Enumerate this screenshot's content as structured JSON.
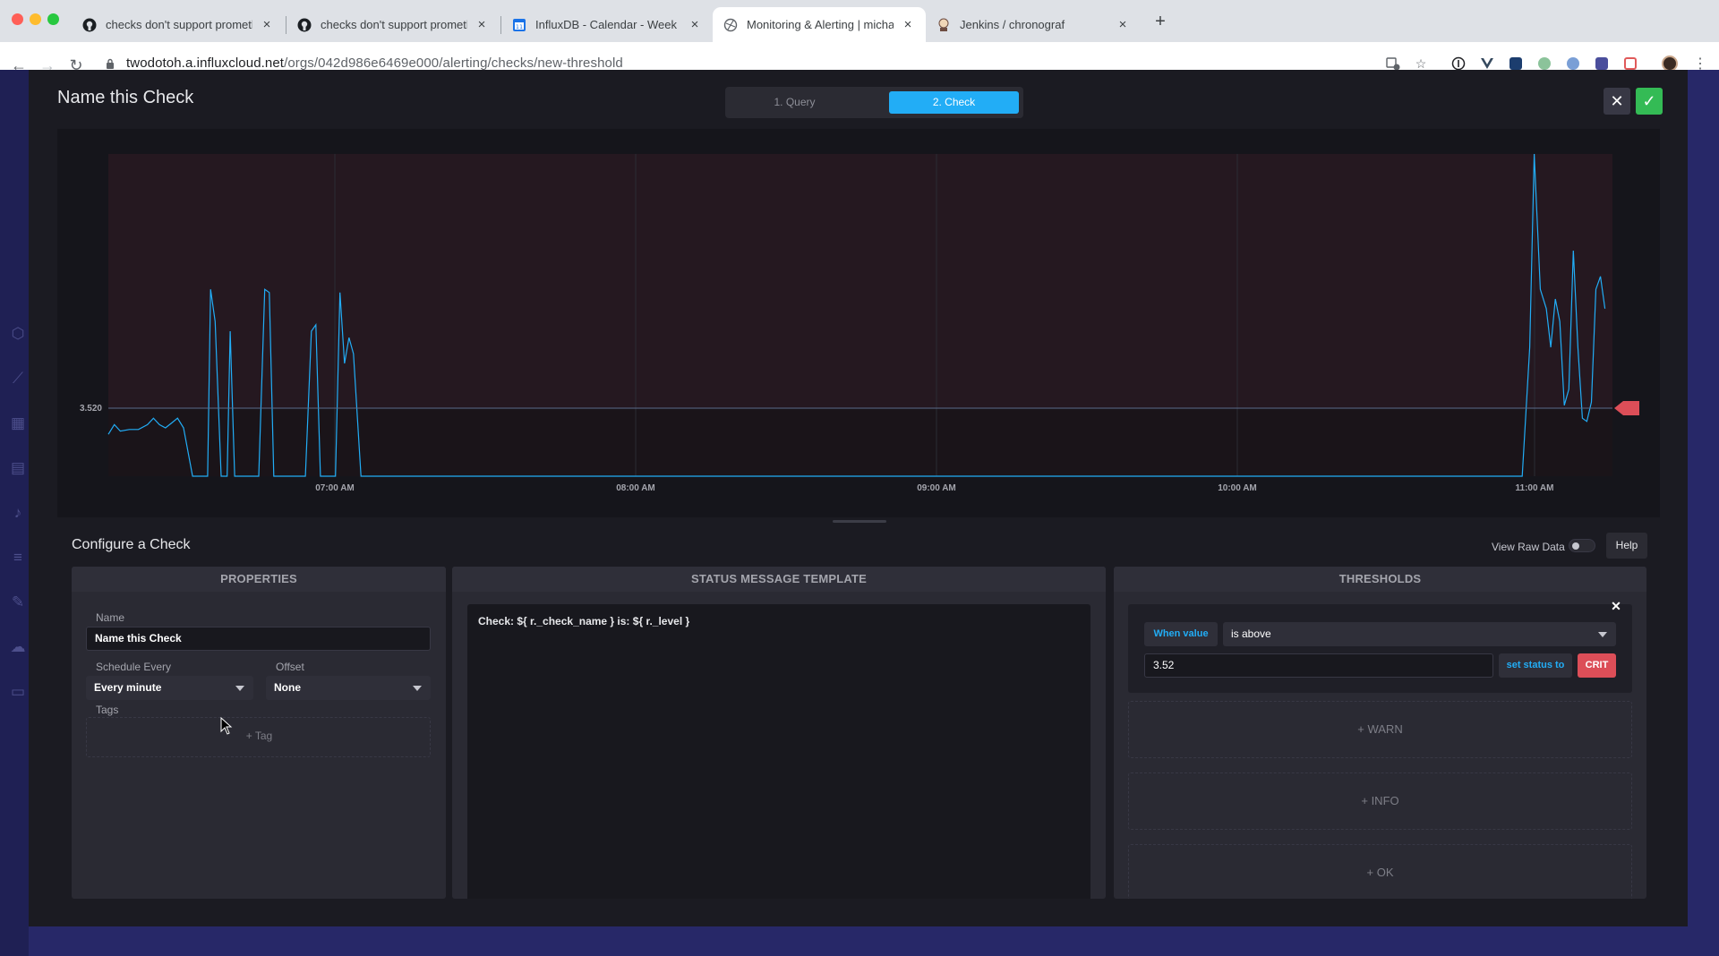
{
  "browser": {
    "tabs": [
      {
        "title": "checks don't support prometheus",
        "icon": "github-icon",
        "active": false
      },
      {
        "title": "checks don't support prometheus",
        "icon": "github-icon",
        "active": false
      },
      {
        "title": "InfluxDB - Calendar - Week of N",
        "icon": "calendar-icon",
        "active": false
      },
      {
        "title": "Monitoring & Alerting | michael@",
        "icon": "influxdb-icon",
        "active": true
      },
      {
        "title": "Jenkins / chronograf",
        "icon": "jenkins-icon",
        "active": false
      }
    ],
    "url_host": "twodotoh.a.influxcloud.net",
    "url_path": "/orgs/042d986e6469e000/alerting/checks/new-threshold"
  },
  "overlay": {
    "title": "Name this Check",
    "steps": [
      "1. Query",
      "2. Check"
    ],
    "active_step": 1
  },
  "chart_data": {
    "type": "line",
    "x_ticks": [
      "07:00 AM",
      "08:00 AM",
      "09:00 AM",
      "10:00 AM",
      "11:00 AM"
    ],
    "threshold": {
      "value": 3.52,
      "label": "3.520",
      "level": "CRIT"
    },
    "series_color": "#22adf6",
    "series": [
      {
        "values": [
          [
            0.0,
            0.22
          ],
          [
            0.004,
            0.16
          ],
          [
            0.008,
            0.15
          ],
          [
            0.014,
            0.15
          ],
          [
            0.02,
            0.14
          ],
          [
            0.026,
            0.15
          ],
          [
            0.03,
            0.17
          ],
          [
            0.034,
            0.18
          ],
          [
            0.038,
            0.16
          ],
          [
            0.042,
            0.15
          ],
          [
            0.046,
            0.17
          ],
          [
            0.05,
            0.16
          ],
          [
            0.056,
            1.0
          ],
          [
            0.062,
            1.0
          ],
          [
            0.068,
            1.0
          ],
          [
            0.074,
            1.0
          ],
          [
            0.08,
            1.0
          ],
          [
            0.085,
            1.0
          ],
          [
            0.0875,
            0.57
          ],
          [
            0.09,
            0.4
          ],
          [
            0.093,
            0.52
          ],
          [
            0.096,
            1.0
          ],
          [
            0.1,
            1.0
          ],
          [
            0.104,
            0.73
          ],
          [
            0.108,
            1.0
          ],
          [
            0.11,
            1.0
          ],
          [
            0.113,
            1.0
          ],
          [
            0.1175,
            1.0
          ],
          [
            0.121,
            1.0
          ],
          [
            0.124,
            1.0
          ],
          [
            0.127,
            1.0
          ],
          [
            0.131,
            1.0
          ],
          [
            0.135,
            1.0
          ],
          [
            0.138,
            1.0
          ],
          [
            0.1405,
            0.59
          ],
          [
            0.144,
            1.0
          ],
          [
            0.148,
            1.0
          ],
          [
            0.152,
            1.0
          ],
          [
            0.156,
            1.0
          ],
          [
            0.159,
            1.0
          ],
          [
            0.162,
            1.0
          ],
          [
            0.165,
            1.0
          ],
          [
            0.169,
            1.0
          ],
          [
            0.172,
            1.0
          ],
          [
            0.175,
            1.0
          ],
          [
            0.178,
            1.0
          ],
          [
            0.183,
            1.0
          ],
          [
            0.191,
            1.0
          ],
          [
            0.198,
            1.0
          ],
          [
            0.204,
            1.0
          ],
          [
            0.208,
            1.0
          ],
          [
            0.211,
            1.0
          ],
          [
            0.214,
            1.0
          ],
          [
            0.216,
            1.0
          ],
          [
            0.219,
            1.0
          ],
          [
            0.221,
            1.0
          ],
          [
            0.224,
            1.0
          ],
          [
            0.227,
            1.0
          ],
          [
            0.229,
            1.0
          ],
          [
            0.231,
            1.0
          ],
          [
            0.232,
            1.0
          ],
          [
            0.234,
            1.0
          ],
          [
            0.238,
            1.0
          ],
          [
            0.25,
            1.0
          ],
          [
            0.35,
            1.0
          ],
          [
            0.45,
            1.0
          ],
          [
            0.55,
            1.0
          ],
          [
            0.65,
            1.0
          ],
          [
            0.75,
            1.0
          ],
          [
            0.85,
            1.0
          ],
          [
            0.9,
            1.0
          ],
          [
            0.94,
            1.0
          ]
        ]
      }
    ]
  },
  "configure": {
    "title": "Configure a Check",
    "view_raw_label": "View Raw Data",
    "help_label": "Help"
  },
  "properties": {
    "header": "PROPERTIES",
    "name_label": "Name",
    "name_value": "Name this Check",
    "schedule_label": "Schedule Every",
    "schedule_value": "Every minute",
    "offset_label": "Offset",
    "offset_value": "None",
    "tags_label": "Tags",
    "add_tag_label": "+ Tag"
  },
  "message": {
    "header": "STATUS MESSAGE TEMPLATE",
    "template": "Check: ${ r._check_name } is: ${ r._level }"
  },
  "thresholds": {
    "header": "THRESHOLDS",
    "when_label": "When value",
    "condition": "is above",
    "value": "3.52",
    "set_status_label": "set status to",
    "level": "CRIT",
    "add_levels": [
      "+ WARN",
      "+ INFO",
      "+ OK"
    ]
  },
  "colors": {
    "accent": "#22adf6",
    "success": "#34bb55",
    "crit": "#dc4e58"
  }
}
